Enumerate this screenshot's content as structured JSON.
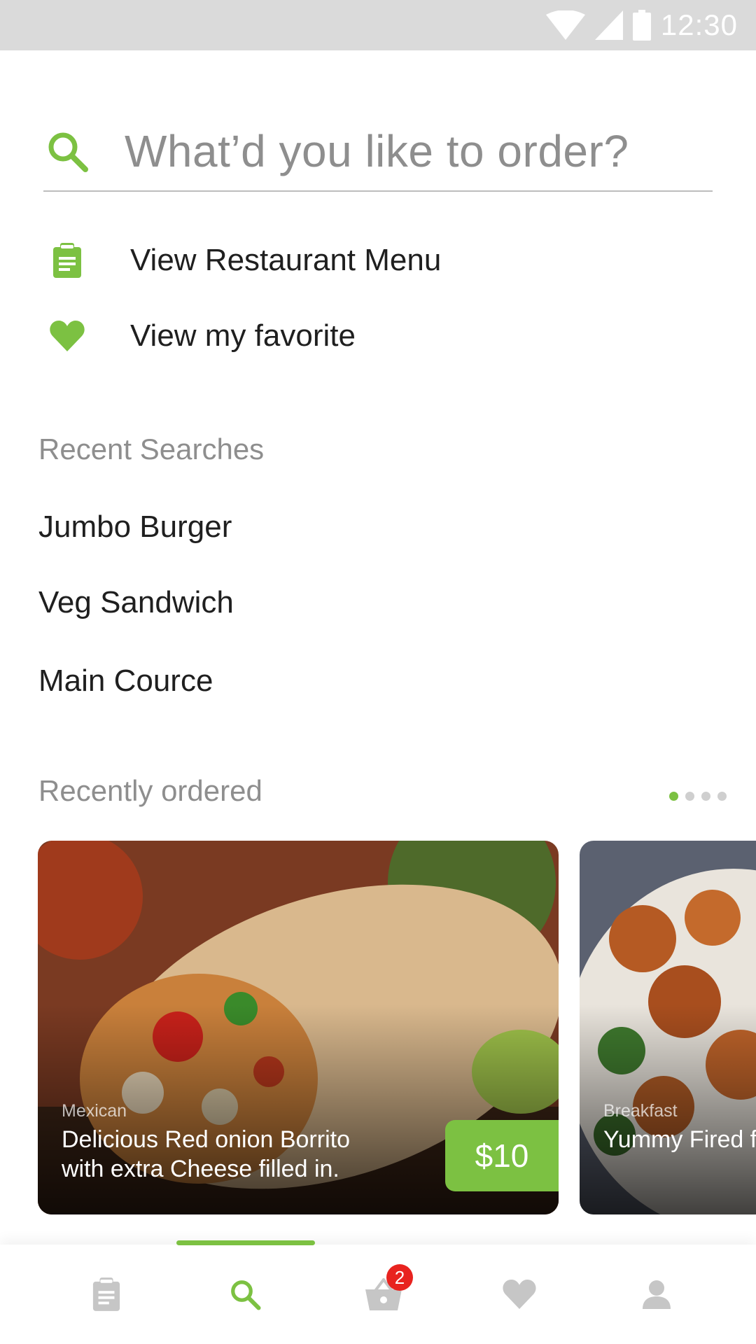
{
  "status_bar": {
    "time": "12:30",
    "icons": [
      "wifi-icon",
      "signal-icon",
      "battery-icon"
    ]
  },
  "search": {
    "placeholder": "What’d you like to order?",
    "icon": "search-icon"
  },
  "quick_actions": [
    {
      "label": "View Restaurant Menu",
      "icon": "clipboard-icon"
    },
    {
      "label": "View my favorite",
      "icon": "heart-icon"
    }
  ],
  "recent_searches": {
    "title": "Recent Searches",
    "items": [
      "Jumbo Burger",
      "Veg Sandwich",
      "Main Cource"
    ]
  },
  "recently_ordered": {
    "title": "Recently ordered",
    "pager": {
      "pages": 4,
      "active": 0
    },
    "cards": [
      {
        "category": "Mexican",
        "title": "Delicious Red onion Borrito with extra Cheese filled in.",
        "price": "$10"
      },
      {
        "category": "Breakfast",
        "title": "Yummy Fired for a spinach"
      }
    ]
  },
  "bottom_nav": {
    "items": [
      "clipboard-icon",
      "search-icon",
      "basket-icon",
      "heart-icon",
      "person-icon"
    ],
    "active_index": 1,
    "cart_badge": "2"
  },
  "colors": {
    "accent": "#7cc142",
    "badge": "#e8231f",
    "muted_text": "#8e8e8e"
  }
}
